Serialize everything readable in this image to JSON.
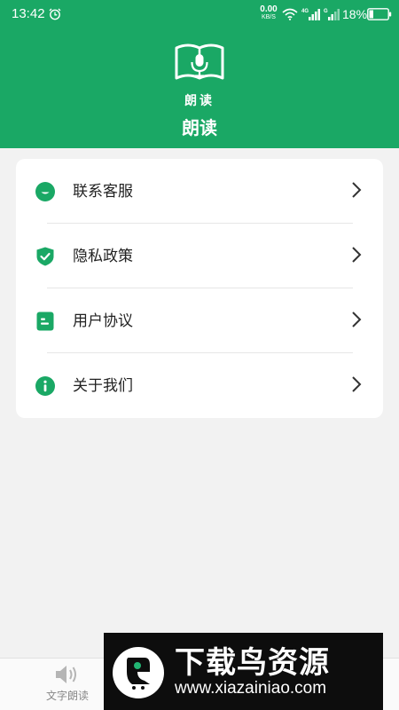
{
  "status_bar": {
    "time": "13:42",
    "net_speed_value": "0.00",
    "net_speed_unit": "KB/S",
    "network_type": "4G",
    "battery_percent": "18%",
    "icons": [
      "alarm-icon",
      "wifi-icon",
      "signal-icon",
      "battery-icon"
    ]
  },
  "header": {
    "logo_text": "朗读",
    "title": "朗读",
    "background_color": "#1aa865"
  },
  "menu": {
    "items": [
      {
        "label": "联系客服",
        "icon": "customer-service-icon"
      },
      {
        "label": "隐私政策",
        "icon": "shield-check-icon"
      },
      {
        "label": "用户协议",
        "icon": "document-icon"
      },
      {
        "label": "关于我们",
        "icon": "info-icon"
      }
    ]
  },
  "bottom_nav": {
    "tabs": [
      {
        "label": "文字朗读",
        "icon": "speaker-icon"
      }
    ]
  },
  "watermark": {
    "title": "下载鸟资源",
    "url": "www.xiazainiao.com"
  },
  "colors": {
    "accent": "#1aa865",
    "background": "#f2f2f2",
    "card": "#ffffff"
  }
}
